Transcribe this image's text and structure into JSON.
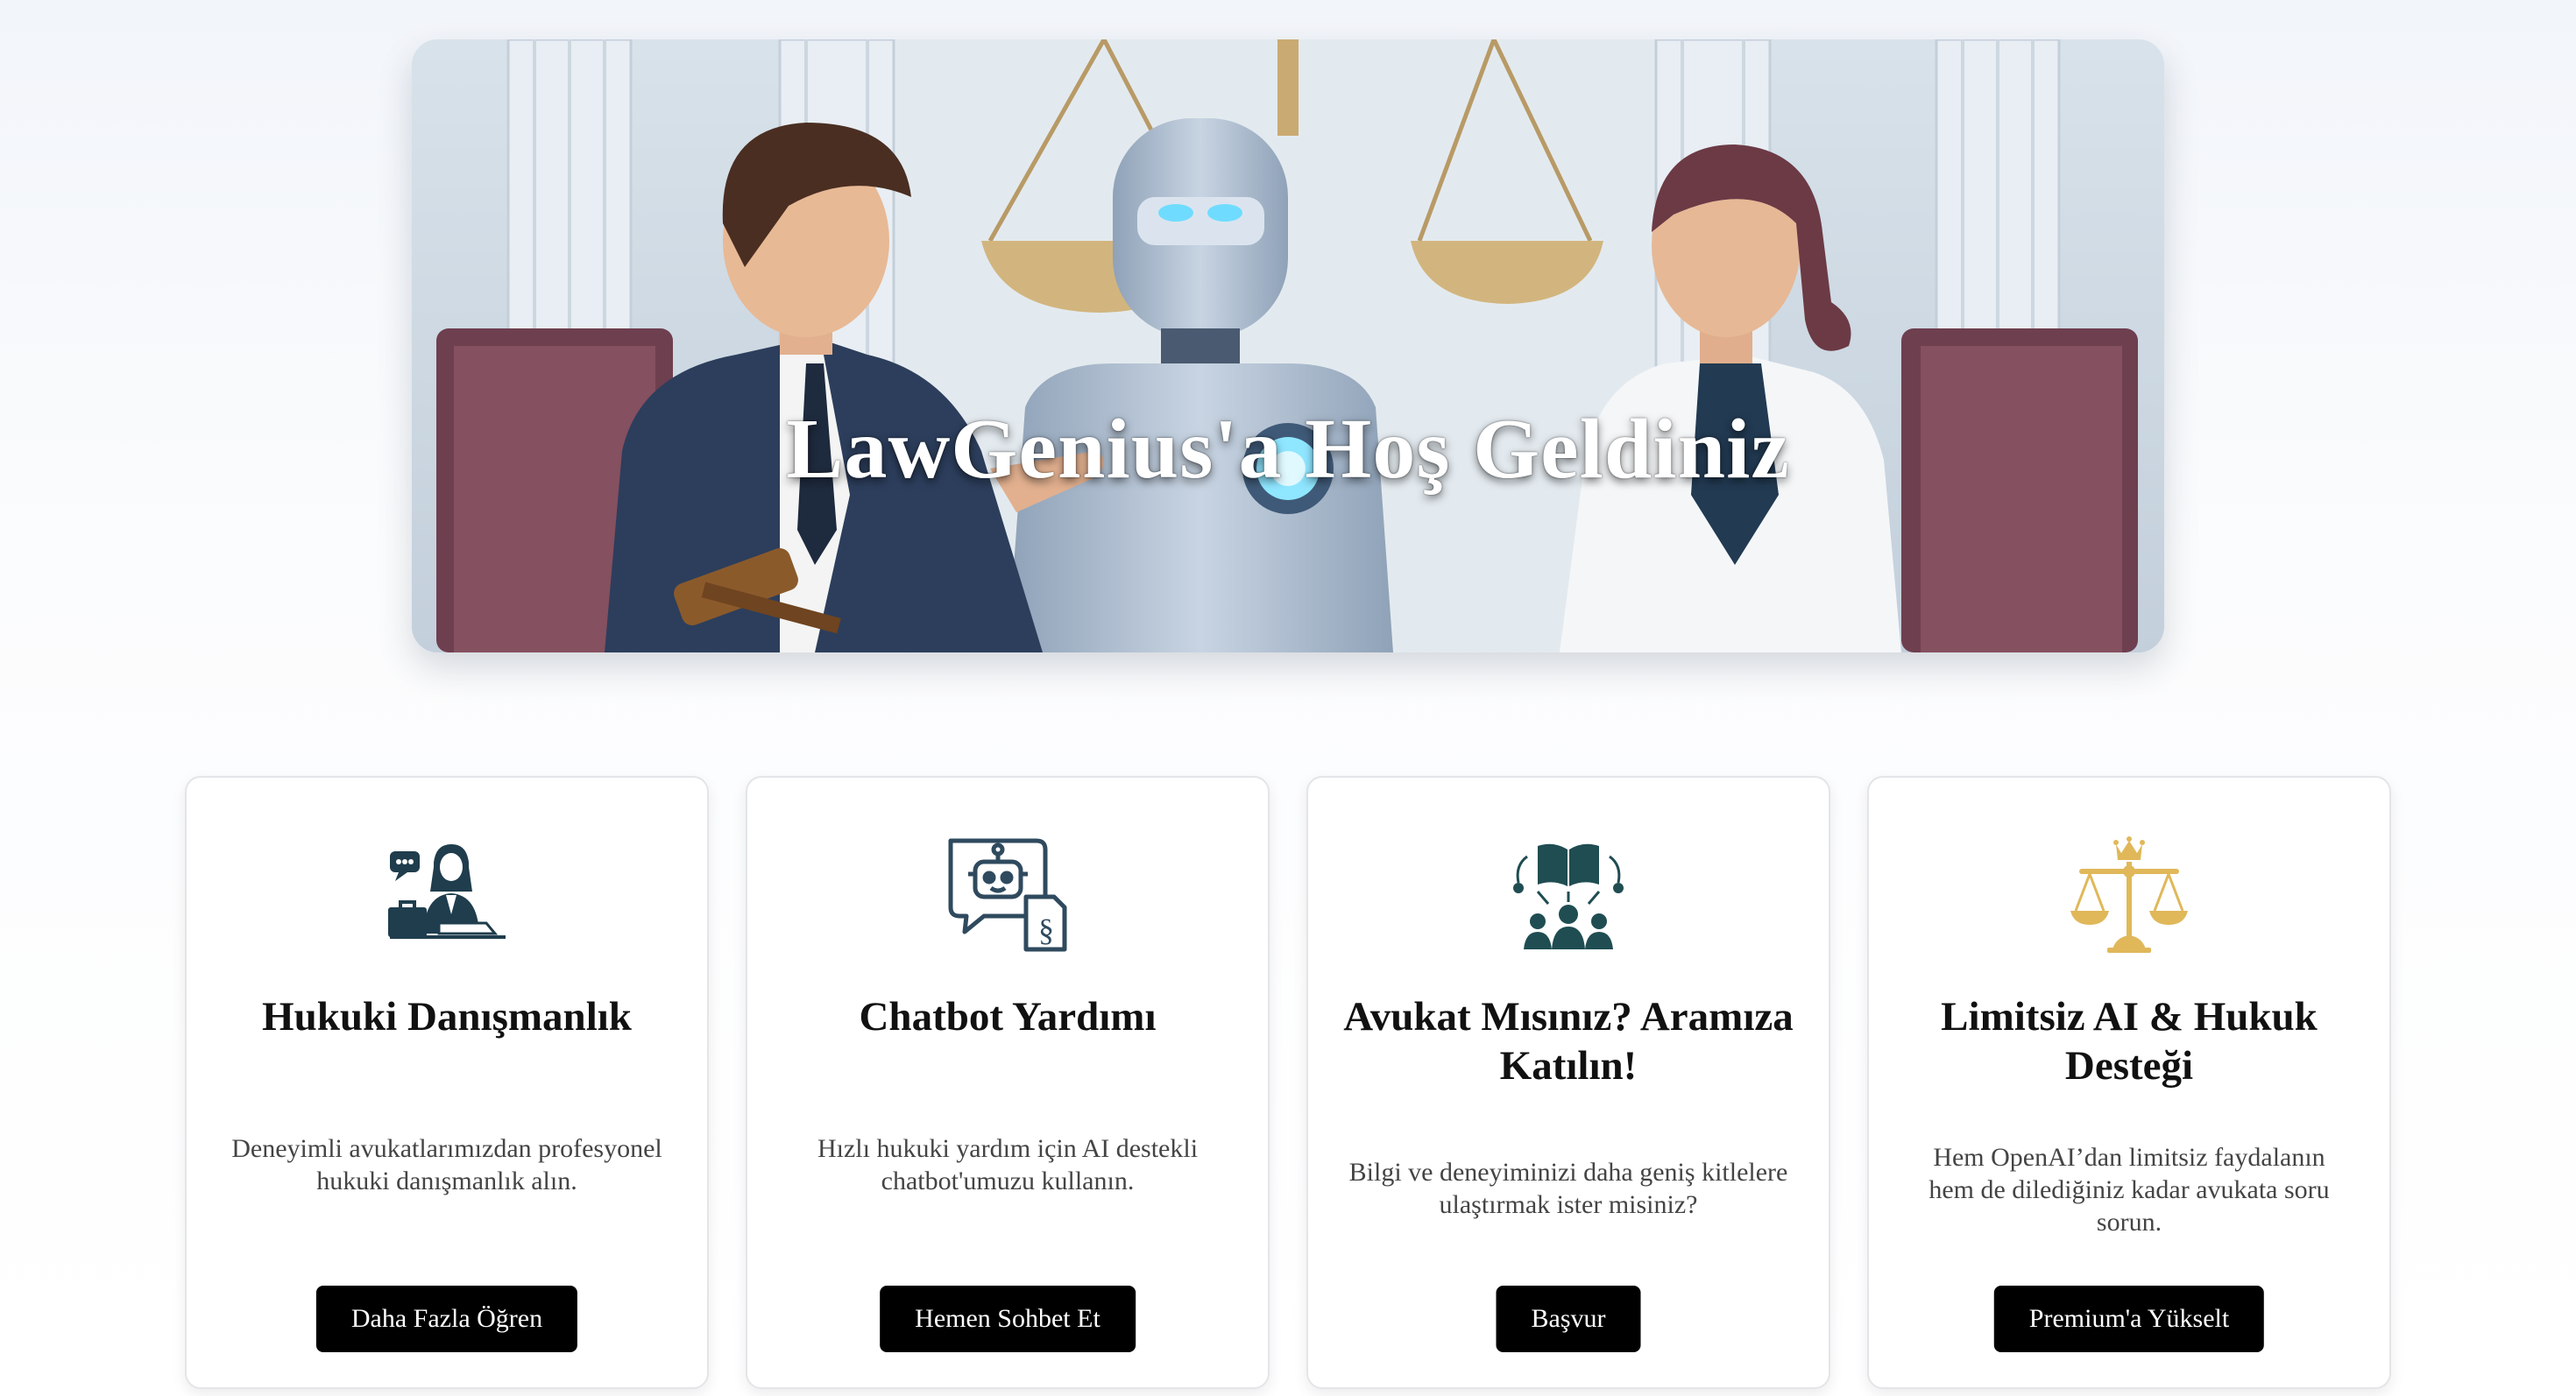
{
  "hero": {
    "title": "LawGenius'a Hoş Geldiniz",
    "illustration": "lawyers-and-robot-with-scales"
  },
  "cards": [
    {
      "icon": "lawyer-consultation-icon",
      "icon_color": "#1f3d4d",
      "title": "Hukuki Danışmanlık",
      "text": "Deneyimli avukatlarımızdan profesyonel hukuki danışmanlık alın.",
      "button": "Daha Fazla Öğren"
    },
    {
      "icon": "chatbot-law-icon",
      "icon_color": "#2f4a5e",
      "title": "Chatbot Yardımı",
      "text": "Hızlı hukuki yardım için AI destekli chatbot'umuzu kullanın.",
      "button": "Hemen Sohbet Et"
    },
    {
      "icon": "lawyer-network-icon",
      "icon_color": "#1f4d52",
      "title": "Avukat Mısınız? Aramıza Katılın!",
      "text": "Bilgi ve deneyiminizi daha geniş kitlelere ulaştırmak ister misiniz?",
      "button": "Başvur"
    },
    {
      "icon": "premium-scales-crown-icon",
      "icon_color": "#e0b85a",
      "title": "Limitsiz AI & Hukuk Desteği",
      "text": "Hem OpenAI’dan limitsiz faydalanın hem de dilediğiniz kadar avukata soru sorun.",
      "button": "Premium'a Yükselt"
    }
  ],
  "colors": {
    "button_bg": "#000000",
    "button_text": "#ffffff",
    "accent_gold": "#e0b85a"
  }
}
